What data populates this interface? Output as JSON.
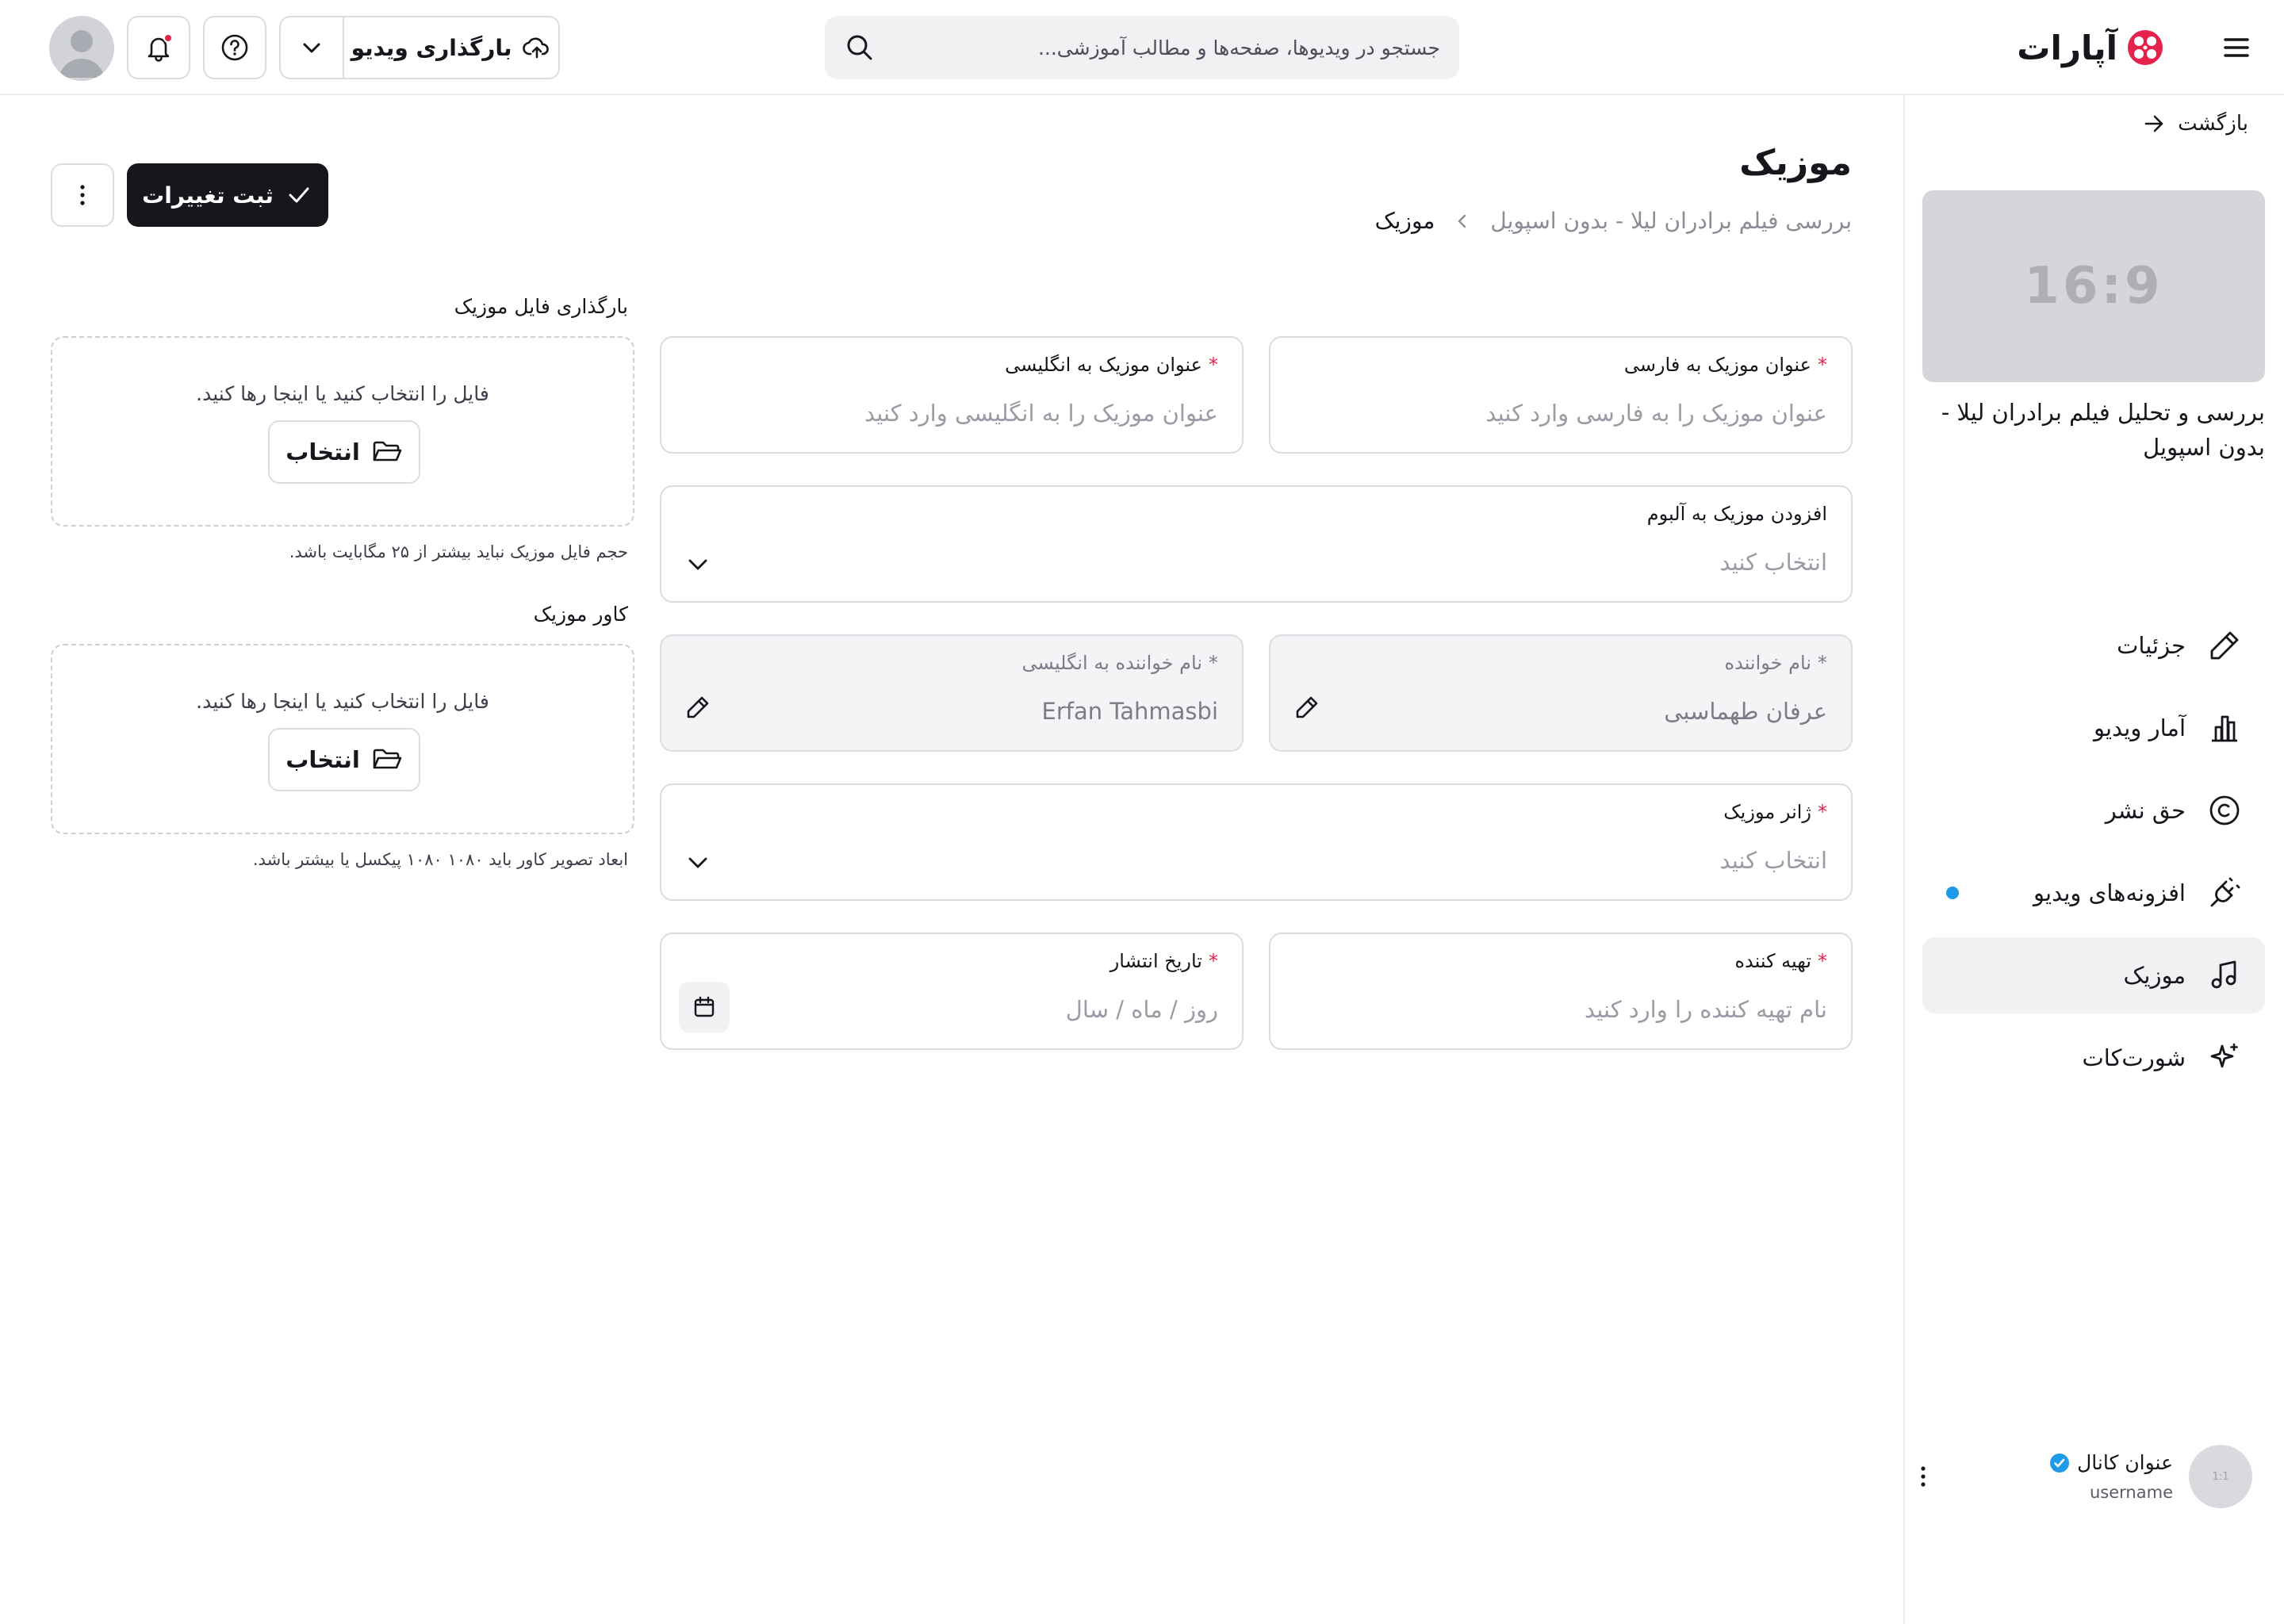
{
  "header": {
    "logo_text": "آپارات",
    "search_placeholder": "جستجو در ویدیوها، صفحه‌ها و مطالب آموزشی...",
    "upload_label": "بارگذاری ویدیو"
  },
  "sidebar": {
    "back_label": "بازگشت",
    "thumb_ratio": "16:9",
    "video_title": "بررسی و تحلیل فیلم برادران لیلا - بدون اسپویل",
    "nav": [
      {
        "label": "جزئیات",
        "icon": "pencil-icon"
      },
      {
        "label": "آمار ویدیو",
        "icon": "bar-chart-icon"
      },
      {
        "label": "حق نشر",
        "icon": "copyright-icon"
      },
      {
        "label": "افزونه‌های ویدیو",
        "icon": "plug-icon",
        "badge": true
      },
      {
        "label": "موزیک",
        "icon": "music-note-icon",
        "active": true
      },
      {
        "label": "شورت‌کات",
        "icon": "sparkle-icon"
      }
    ],
    "channel": {
      "name": "عنوان کانال",
      "username": "username",
      "avatar_ratio": "1:1"
    }
  },
  "main": {
    "title": "موزیک",
    "breadcrumb": [
      "بررسی فیلم برادران لیلا - بدون اسپویل",
      "موزیک"
    ],
    "save_label": "ثبت تغییرات",
    "fields": {
      "title_fa": {
        "label": "عنوان موزیک به فارسی",
        "placeholder": "عنوان موزیک را به فارسی وارد کنید"
      },
      "title_en": {
        "label": "عنوان موزیک به انگلیسی",
        "placeholder": "عنوان موزیک را به انگلیسی وارد کنید"
      },
      "album": {
        "label": "افزودن موزیک به آلبوم",
        "placeholder": "انتخاب کنید"
      },
      "singer_fa": {
        "label": "نام خواننده",
        "value": "عرفان طهماسبی"
      },
      "singer_en": {
        "label": "نام خواننده به انگلیسی",
        "value": "Erfan Tahmasbi"
      },
      "genre": {
        "label": "ژانر موزیک",
        "placeholder": "انتخاب کنید"
      },
      "producer": {
        "label": "تهیه کننده",
        "placeholder": "نام تهیه کننده را وارد کنید"
      },
      "release_date": {
        "label": "تاریخ انتشار",
        "placeholder": "روز / ماه / سال"
      }
    },
    "upload_music": {
      "label": "بارگذاری فایل موزیک",
      "drop_text": "فایل را انتخاب کنید یا اینجا رها کنید.",
      "button": "انتخاب",
      "hint": "حجم فایل موزیک نباید بیشتر از ۲۵ مگابایت باشد."
    },
    "cover": {
      "label": "کاور موزیک",
      "drop_text": "فایل را انتخاب کنید یا اینجا رها کنید.",
      "button": "انتخاب",
      "hint": "ابعاد تصویر کاور باید ۱۰۸۰ ۱۰۸۰ پیکسل یا بیشتر باشد."
    }
  }
}
